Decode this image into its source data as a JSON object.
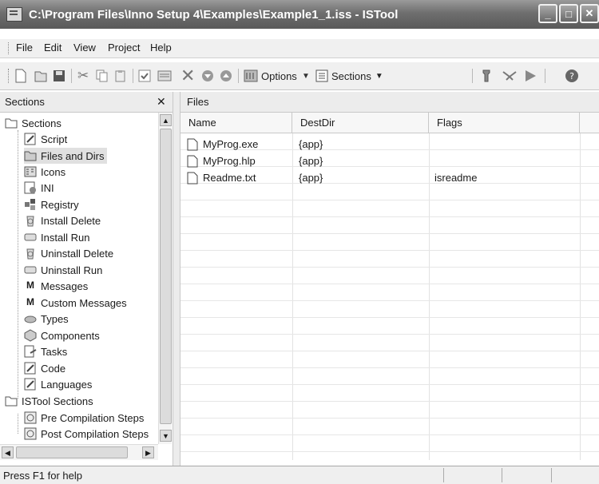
{
  "window": {
    "title": "C:\\Program Files\\Inno Setup 4\\Examples\\Example1_1.iss - ISTool"
  },
  "menu": [
    "File",
    "Edit",
    "View",
    "Project",
    "Help"
  ],
  "toolbar": {
    "options_label": "Options",
    "sections_label": "Sections"
  },
  "sidebar": {
    "title": "Sections",
    "close_glyph": "✕",
    "tree": [
      {
        "label": "Sections",
        "icon": "folder-icon"
      },
      {
        "label": "Script",
        "icon": "script-icon"
      },
      {
        "label": "Files and Dirs",
        "icon": "files-icon",
        "selected": true
      },
      {
        "label": "Icons",
        "icon": "icons-icon"
      },
      {
        "label": "INI",
        "icon": "ini-icon"
      },
      {
        "label": "Registry",
        "icon": "registry-icon"
      },
      {
        "label": "Install Delete",
        "icon": "install-delete-icon"
      },
      {
        "label": "Install Run",
        "icon": "install-run-icon"
      },
      {
        "label": "Uninstall Delete",
        "icon": "uninstall-delete-icon"
      },
      {
        "label": "Uninstall Run",
        "icon": "uninstall-run-icon"
      },
      {
        "label": "Messages",
        "icon": "messages-icon"
      },
      {
        "label": "Custom Messages",
        "icon": "custom-messages-icon"
      },
      {
        "label": "Types",
        "icon": "types-icon"
      },
      {
        "label": "Components",
        "icon": "components-icon"
      },
      {
        "label": "Tasks",
        "icon": "tasks-icon"
      },
      {
        "label": "Code",
        "icon": "code-icon"
      },
      {
        "label": "Languages",
        "icon": "languages-icon"
      },
      {
        "label": "ISTool Sections",
        "icon": "folder-icon"
      },
      {
        "label": "Pre Compilation Steps",
        "icon": "pre-compile-icon"
      },
      {
        "label": "Post Compilation Steps",
        "icon": "post-compile-icon"
      }
    ]
  },
  "main": {
    "title": "Files",
    "columns": [
      "Name",
      "DestDir",
      "Flags"
    ],
    "rows": [
      {
        "name": "MyProg.exe",
        "destdir": "{app}",
        "flags": ""
      },
      {
        "name": "MyProg.hlp",
        "destdir": "{app}",
        "flags": ""
      },
      {
        "name": "Readme.txt",
        "destdir": "{app}",
        "flags": "isreadme"
      }
    ]
  },
  "status": {
    "text": "Press F1 for help"
  }
}
